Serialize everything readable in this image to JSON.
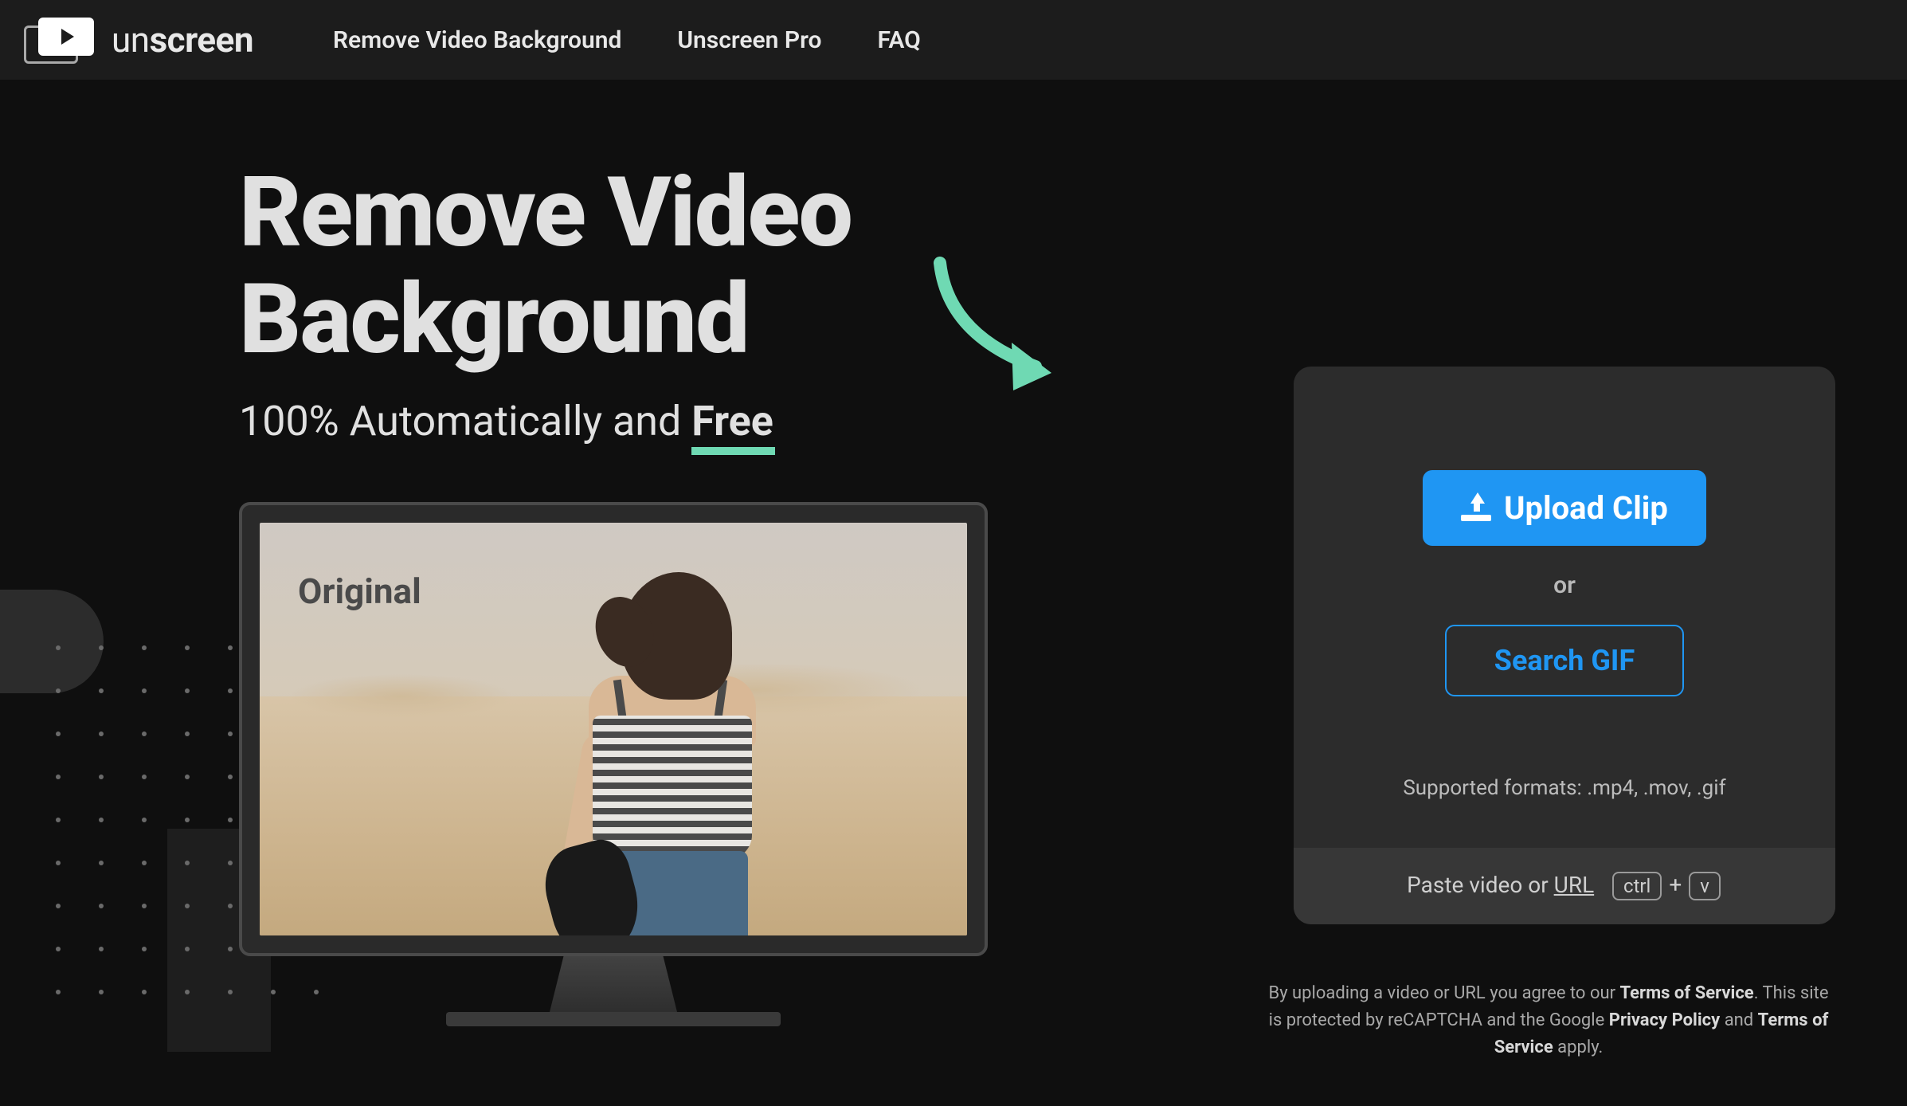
{
  "brand": {
    "prefix": "un",
    "suffix": "screen"
  },
  "nav": {
    "remove": "Remove Video Background",
    "pro": "Unscreen Pro",
    "faq": "FAQ"
  },
  "hero": {
    "title_l1": "Remove Video",
    "title_l2": "Background",
    "sub_prefix": "100% Automatically and ",
    "sub_free": "Free"
  },
  "preview": {
    "label": "Original"
  },
  "card": {
    "upload": "Upload Clip",
    "or": "or",
    "search": "Search GIF",
    "formats": "Supported formats: .mp4, .mov, .gif",
    "paste_prefix": "Paste video or ",
    "paste_url": "URL",
    "kbd_ctrl": "ctrl",
    "kbd_plus": "+",
    "kbd_v": "v"
  },
  "legal": {
    "t1": "By uploading a video or URL you agree to our ",
    "tos": "Terms of Service",
    "t2": ". This site is protected by reCAPTCHA and the Google ",
    "pp": "Privacy Policy",
    "t3": " and ",
    "tos2": "Terms of Service",
    "t4": " apply."
  }
}
